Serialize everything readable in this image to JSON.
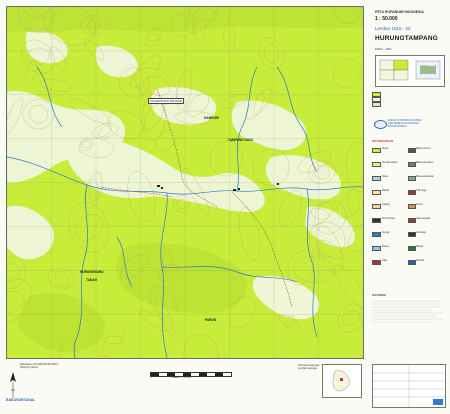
{
  "header": {
    "series": "PETA RUPABUMI INDONESIA",
    "scale": "1 : 50.000",
    "sheet_number": "Lembar 1615 - 22",
    "sheet_name": "HURUNGTAMPANG",
    "edition": "EDISI I - 2007"
  },
  "map": {
    "labels": {
      "pal_box": "KALIMANTAN TENGAH",
      "kampuri": "KAMPURI",
      "tampang": "TAMPANG RAYA",
      "hurungmuhu": "HURUNGMUHU",
      "tanah": "TANAH",
      "parun": "PARUN"
    },
    "colors": {
      "forest": "#c8ec3a",
      "clearing": "#f1f6dd",
      "river": "#2e79c9",
      "contour": "#c79a5a",
      "frame": "#6d6d6d"
    }
  },
  "legend": {
    "logo_lines": [
      "BADAN KOORDINASI SURVEI",
      "DAN PEMETAAN NASIONAL",
      "BAKOSURTANAL"
    ],
    "section_title": "KETERANGAN",
    "items_left": [
      "Hutan",
      "Semak belukar",
      "Rawa",
      "Sawah",
      "Ladang",
      "Permukiman",
      "Sungai",
      "Danau",
      "Jalan"
    ],
    "items_right": [
      "Batas provinsi",
      "Batas kabupaten",
      "Batas kecamatan",
      "Titik tinggi",
      "Kontur",
      "Jalan setapak",
      "Jembatan",
      "Masjid",
      "Sekolah"
    ],
    "notes_title": "CATATAN"
  },
  "footer": {
    "left_lines": [
      "Diterbitkan oleh BAKOSURTANAL",
      "Cibinong, Bogor"
    ],
    "scale_text": "Skala 1 : 50.000",
    "right_lines": [
      "Petunjuk letak peta",
      "Lembar tetangga"
    ],
    "blue_note": "BAKOSURTANAL"
  }
}
